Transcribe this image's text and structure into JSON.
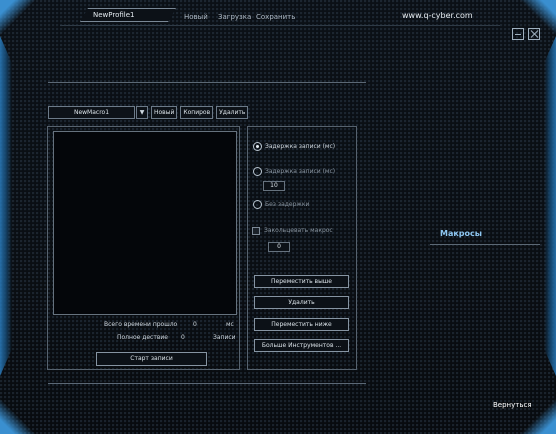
{
  "app": {
    "profile_tab": "NewProfile1",
    "menu": [
      "Новый",
      "Загрузка",
      "Сохранить"
    ],
    "site": "www.q-cyber.com"
  },
  "toolbar": {
    "macro_select": "NewMacro1",
    "arrow": "▼",
    "buttons": [
      "Новый",
      "Копиров",
      "Удалить"
    ]
  },
  "macro_panel": {
    "total_time_label": "Всего времени прошло",
    "total_time_value": "0",
    "total_time_unit": "мс",
    "actions_label": "Полное дествие",
    "actions_value": "0",
    "actions_unit": "Записи",
    "start_button": "Старт записи"
  },
  "options": {
    "radio_1": "Задержка записи (мс)",
    "radio_2": "Задержка записи (мс)",
    "delay_value": "10",
    "radio_3": "Без задержки",
    "loop_label": "Закольцевать макрос",
    "loop_value": "0",
    "buttons": [
      "Переместить выше",
      "Удалить",
      "Переместить ниже",
      "Больше Инструментов ..."
    ]
  },
  "side": {
    "section_label": "Макросы",
    "back": "Вернуться"
  },
  "icons": {
    "minimize": "minimize-icon",
    "close": "close-icon",
    "dropdown": "chevron-down-icon"
  }
}
